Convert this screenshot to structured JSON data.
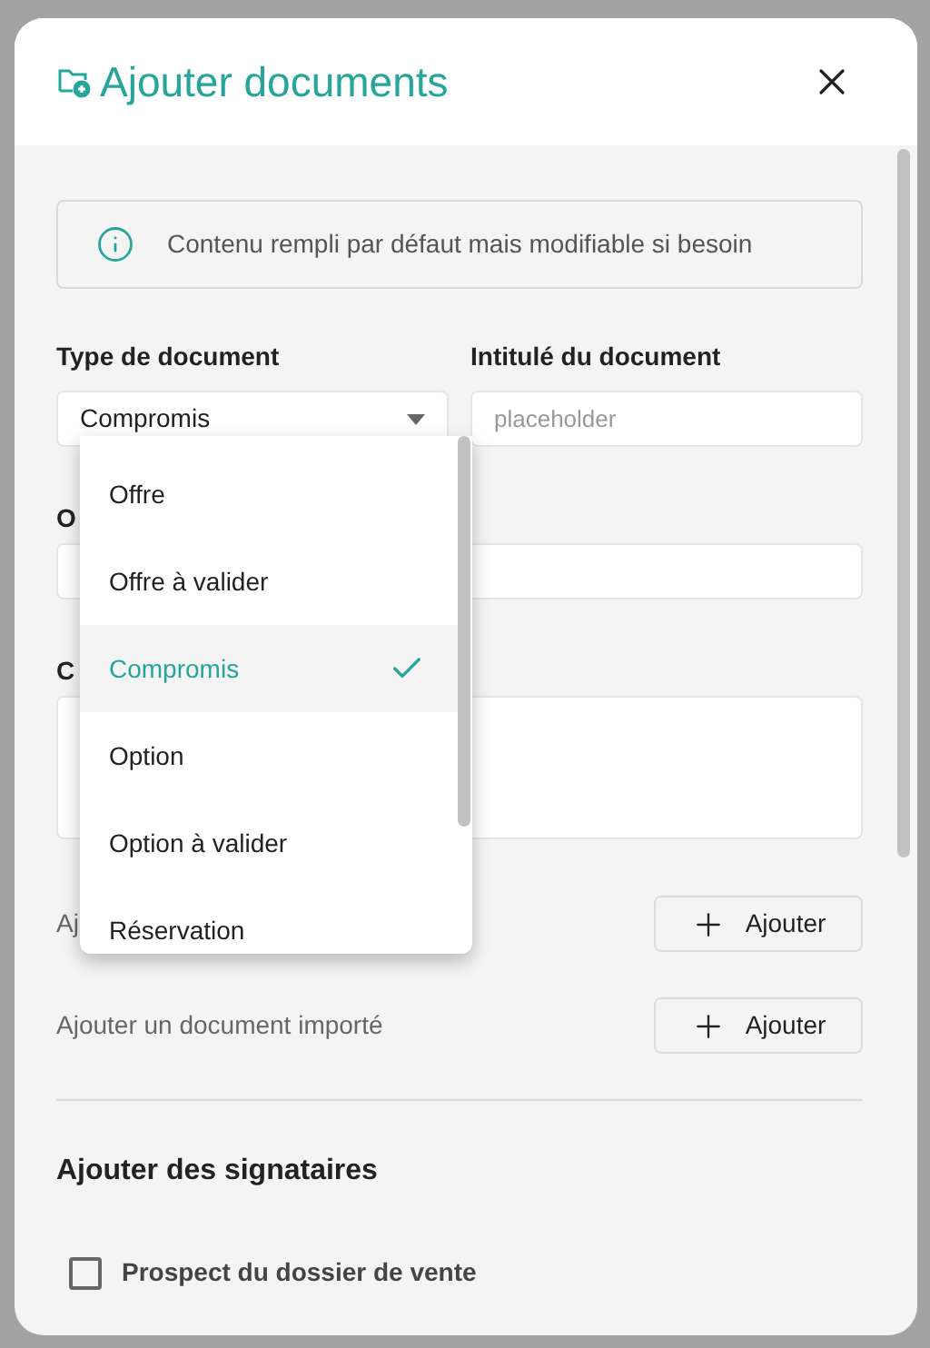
{
  "dialog": {
    "title": "Ajouter documents",
    "info": "Contenu rempli par défaut mais modifiable si besoin"
  },
  "fields": [
    {
      "label": "Type de document",
      "value": "Compromis"
    },
    {
      "label": "Intitulé du document",
      "placeholder": "placeholder"
    }
  ],
  "hidden_labels": [
    "O",
    "C"
  ],
  "dropdown": {
    "options": [
      {
        "label": "Offre",
        "selected": false
      },
      {
        "label": "Offre à valider",
        "selected": false
      },
      {
        "label": "Compromis",
        "selected": true
      },
      {
        "label": "Option",
        "selected": false
      },
      {
        "label": "Option à valider",
        "selected": false
      },
      {
        "label": "Réservation",
        "selected": false
      }
    ]
  },
  "add_rows": [
    {
      "label": "Aj",
      "button": "Ajouter"
    },
    {
      "label": "Ajouter un document importé",
      "button": "Ajouter"
    }
  ],
  "signers": {
    "title": "Ajouter des signataires",
    "items": [
      {
        "label": "Prospect du dossier de vente",
        "checked": false
      }
    ]
  }
}
